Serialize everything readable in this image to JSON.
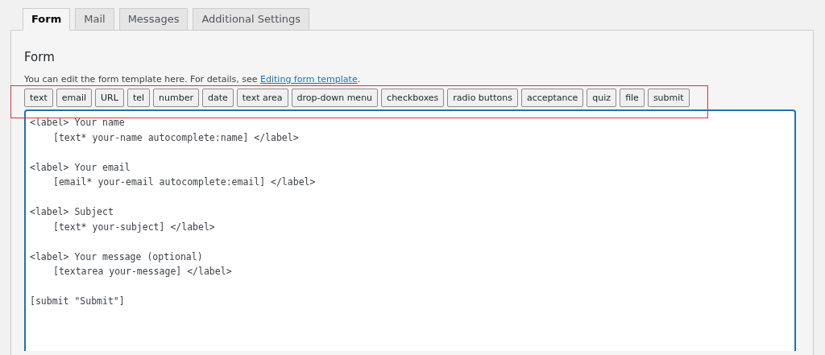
{
  "tabs": [
    {
      "label": "Form",
      "selected": true
    },
    {
      "label": "Mail",
      "selected": false
    },
    {
      "label": "Messages",
      "selected": false
    },
    {
      "label": "Additional Settings",
      "selected": false
    }
  ],
  "panel": {
    "title": "Form",
    "description": "You can edit the form template here. For details, see ",
    "link": "Editing form template",
    "description_end": "."
  },
  "tag_buttons": [
    "text",
    "email",
    "URL",
    "tel",
    "number",
    "date",
    "text area",
    "drop-down menu",
    "checkboxes",
    "radio buttons",
    "acceptance",
    "quiz",
    "file",
    "submit"
  ],
  "editor": {
    "blocks": [
      {
        "lines": [
          {
            "kind": "open",
            "text": "<label> Your name"
          },
          {
            "kind": "field",
            "text": "[text* your-name autocomplete:name] </label>"
          }
        ]
      },
      {
        "lines": [
          {
            "kind": "open",
            "text": "<label> Your email"
          },
          {
            "kind": "field",
            "text": "[email* your-email autocomplete:email] </label>"
          }
        ]
      },
      {
        "lines": [
          {
            "kind": "open",
            "text": "<label> Subject"
          },
          {
            "kind": "field",
            "text": "[text* your-subject] </label>"
          }
        ]
      },
      {
        "lines": [
          {
            "kind": "open",
            "text": "<label> Your message (optional)"
          },
          {
            "kind": "field",
            "text": "[textarea your-message] </label>"
          }
        ]
      },
      {
        "lines": [
          {
            "kind": "open",
            "text": "[submit \"Submit\"]"
          }
        ]
      }
    ]
  }
}
